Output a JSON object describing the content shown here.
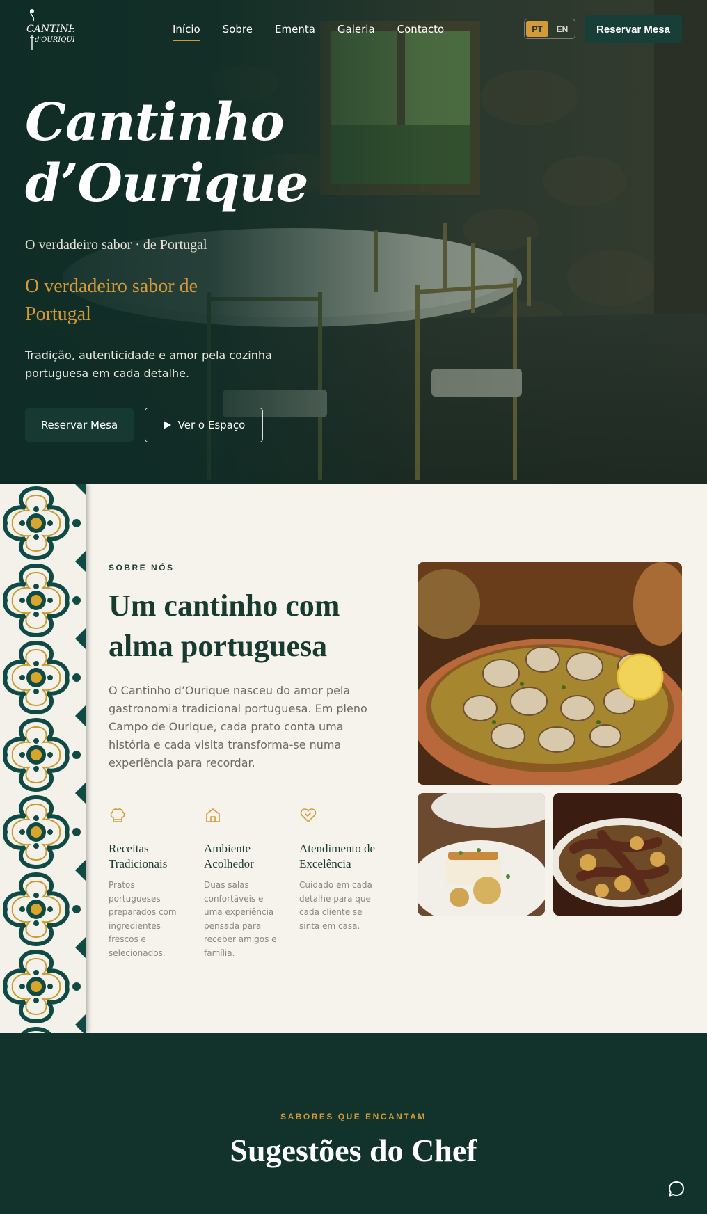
{
  "brand": {
    "logo_line1": "CANTINHO",
    "logo_line2": "d'OURIQUE"
  },
  "nav": {
    "links": [
      {
        "label": "Início",
        "active": true
      },
      {
        "label": "Sobre"
      },
      {
        "label": "Ementa"
      },
      {
        "label": "Galeria"
      },
      {
        "label": "Contacto"
      }
    ],
    "lang": {
      "pt": "PT",
      "en": "EN",
      "selected": "PT"
    },
    "cta": "Reservar Mesa"
  },
  "hero": {
    "title_line1": "Cantinho",
    "title_line2": "d’Ourique",
    "tagline": "O verdadeiro sabor · de Portugal",
    "subtitle": "O verdadeiro sabor de Portugal",
    "description": "Tradição, autenticidade e amor pela cozinha portuguesa em cada detalhe.",
    "btn_primary": "Reservar Mesa",
    "btn_secondary": "Ver o Espaço",
    "btn_secondary_icon": "play-icon"
  },
  "about": {
    "eyebrow": "SOBRE NÓS",
    "title": "Um cantinho com alma portuguesa",
    "text": "O Cantinho d’Ourique nasceu do amor pela gastronomia tradicional portuguesa. Em pleno Campo de Ourique, cada prato conta uma história e cada visita transforma-se numa experiência para recordar.",
    "features": [
      {
        "icon": "chef-hat-icon",
        "title": "Receitas Tradicionais",
        "text": "Pratos portugueses preparados com ingredientes frescos e selecionados."
      },
      {
        "icon": "home-icon",
        "title": "Ambiente Acolhedor",
        "text": "Duas salas confortáveis e uma experiência pensada para receber amigos e família."
      },
      {
        "icon": "heart-handshake-icon",
        "title": "Atendimento de Excelência",
        "text": "Cuidado em cada detalhe para que cada cliente se sinta em casa."
      }
    ]
  },
  "chef": {
    "eyebrow": "SABORES QUE ENCANTAM",
    "title": "Sugestões do Chef"
  },
  "colors": {
    "primary_green": "#163a32",
    "accent_gold": "#d49a3a",
    "cream": "#f6f3ec"
  },
  "chat": {
    "icon": "chat-bubble-icon"
  }
}
